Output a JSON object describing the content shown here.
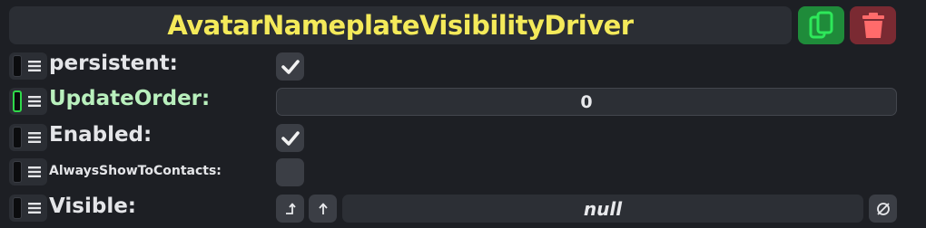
{
  "component": {
    "title": "AvatarNameplateVisibilityDriver",
    "duplicate_icon": "duplicate-icon",
    "delete_icon": "trash-icon",
    "colors": {
      "title": "#f4ea5a",
      "duplicate_button": "#1f8b3a",
      "delete_button": "#7a2a32",
      "linked_slot": "#2fd94a"
    }
  },
  "fields": {
    "persistent": {
      "label": "persistent:",
      "checked": true
    },
    "update_order": {
      "label": "UpdateOrder:",
      "value": "0"
    },
    "enabled": {
      "label": "Enabled:",
      "checked": true
    },
    "always_show_to_contacts": {
      "label": "AlwaysShowToContacts:",
      "checked": false
    },
    "visible": {
      "label": "Visible:",
      "value": "null"
    }
  }
}
